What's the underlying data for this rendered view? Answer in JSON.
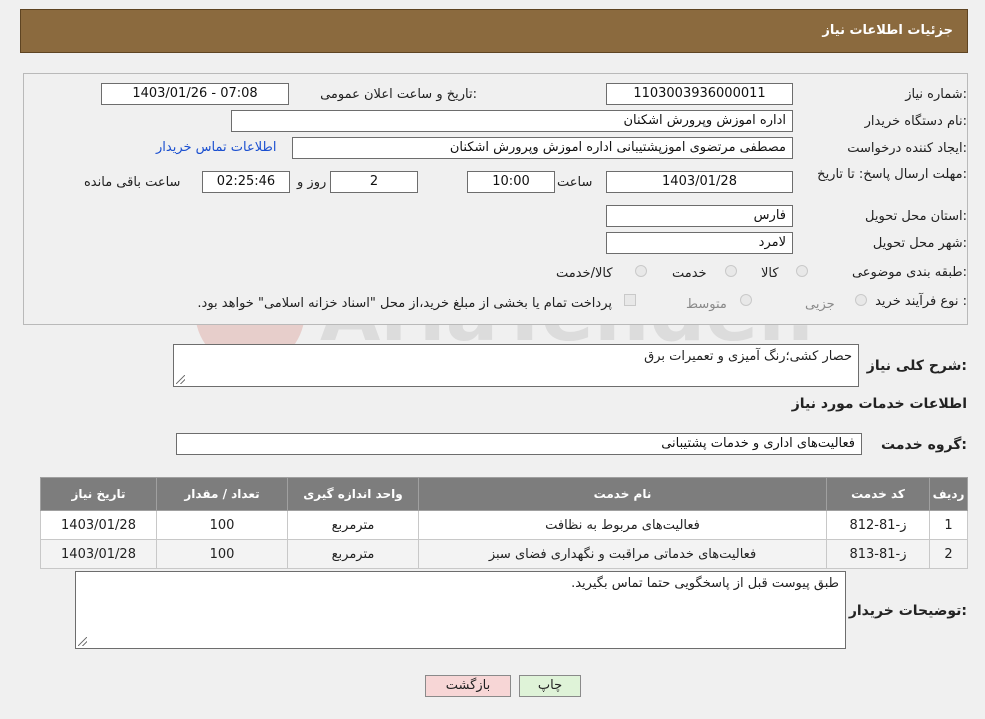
{
  "header": {
    "title": "جزئیات اطلاعات نیاز"
  },
  "form": {
    "need_number_label": "شماره نیاز:",
    "need_number": "1103003936000011",
    "announce_label": "تاریخ و ساعت اعلان عمومی:",
    "announce_value": "1403/01/26 - 07:08",
    "buyer_org_label": "نام دستگاه خریدار:",
    "buyer_org": "اداره اموزش وپرورش اشکنان",
    "creator_label": "ایجاد کننده درخواست:",
    "creator": "مصطفی مرتضوی اموزپشتیبانی اداره اموزش وپرورش اشکنان",
    "contact_link": "اطلاعات تماس خریدار",
    "deadline_label": "مهلت ارسال پاسخ: تا تاریخ:",
    "deadline_date": "1403/01/28",
    "time_label": "ساعت",
    "deadline_time": "10:00",
    "days_value": "2",
    "days_label": "روز و",
    "remaining_value": "02:25:46",
    "remaining_label": "ساعت باقی مانده",
    "province_label": "استان محل تحویل:",
    "province": "فارس",
    "city_label": "شهر محل تحویل:",
    "city": "لامرد",
    "category_label": "طبقه بندی موضوعی:",
    "category_options": [
      "کالا",
      "خدمت",
      "کالا/خدمت"
    ],
    "purchase_type_label": "نوع فرآیند خرید :",
    "purchase_options": [
      "جزیی",
      "متوسط"
    ],
    "purchase_note": "پرداخت تمام یا بخشی از مبلغ خرید،از محل \"اسناد خزانه اسلامی\" خواهد بود."
  },
  "summary": {
    "label": "شرح کلی نیاز:",
    "value": "حصار کشی؛رنگ آمیزی و تعمیرات برق"
  },
  "services": {
    "section_title": "اطلاعات خدمات مورد نیاز",
    "group_label": "گروه خدمت:",
    "group_value": "فعالیت‌های اداری و خدمات پشتیبانی",
    "columns": [
      "ردیف",
      "کد خدمت",
      "نام خدمت",
      "واحد اندازه گیری",
      "تعداد / مقدار",
      "تاریخ نیاز"
    ],
    "rows": [
      [
        "1",
        "ز-81-812",
        "فعالیت‌های مربوط به نظافت",
        "مترمربع",
        "100",
        "1403/01/28"
      ],
      [
        "2",
        "ز-81-813",
        "فعالیت‌های خدماتی مراقبت و نگهداری فضای سبز",
        "مترمربع",
        "100",
        "1403/01/28"
      ]
    ]
  },
  "buyer_notes": {
    "label": "توضیحات خریدار:",
    "value": "طبق پیوست قبل از پاسخگویی حتما تماس بگیرید."
  },
  "buttons": {
    "print": "چاپ",
    "back": "بازگشت"
  },
  "watermark": {
    "text": "AriaTender.neT"
  },
  "colors": {
    "header": "#8b6a3e",
    "table_header": "#7d7d7d",
    "link": "#1a4fd0",
    "back_button": "#f7d6d6",
    "print_button": "#dff3d8"
  }
}
